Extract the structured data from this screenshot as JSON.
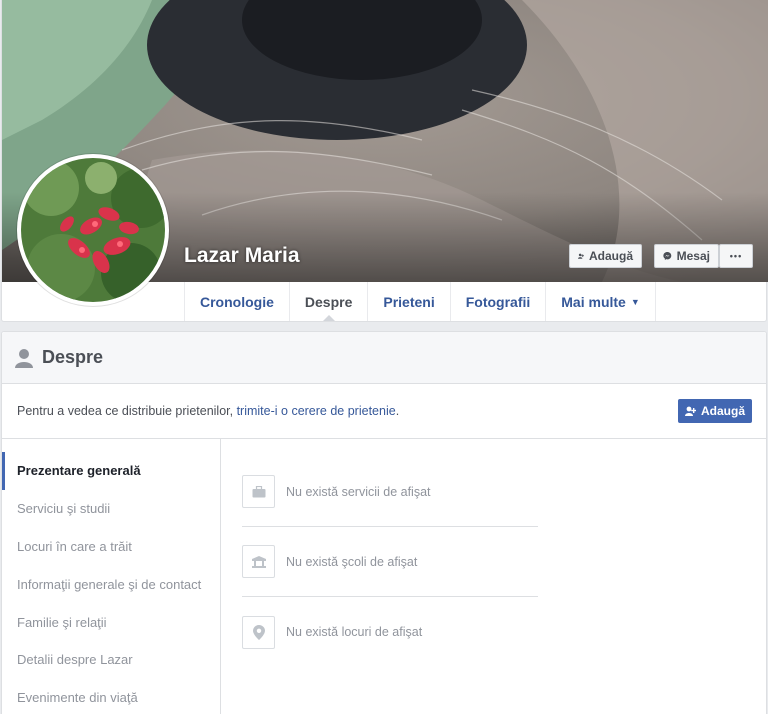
{
  "profile": {
    "name": "Lazar Maria",
    "add_friend_label": "Adaugă",
    "message_label": "Mesaj",
    "more_label": "•••"
  },
  "nav": {
    "tabs": [
      {
        "label": "Cronologie"
      },
      {
        "label": "Despre"
      },
      {
        "label": "Prieteni"
      },
      {
        "label": "Fotografii"
      },
      {
        "label": "Mai multe"
      }
    ],
    "active": "Despre"
  },
  "about": {
    "title": "Despre",
    "notice_prefix": "Pentru a vedea ce distribuie prietenilor, ",
    "notice_link": "trimite-i o cerere de prietenie",
    "notice_suffix": ".",
    "add_friend_label": "Adaugă",
    "sidebar": [
      {
        "label": "Prezentare generală"
      },
      {
        "label": "Serviciu şi studii"
      },
      {
        "label": "Locuri în care a trăit"
      },
      {
        "label": "Informaţii generale şi de contact"
      },
      {
        "label": "Familie şi relaţii"
      },
      {
        "label": "Detalii despre Lazar"
      },
      {
        "label": "Evenimente din viaţă"
      }
    ],
    "empty_states": [
      {
        "icon": "briefcase-icon",
        "text": "Nu există servicii de afişat"
      },
      {
        "icon": "school-icon",
        "text": "Nu există şcoli de afişat"
      },
      {
        "icon": "location-pin-icon",
        "text": "Nu există locuri de afişat"
      }
    ]
  },
  "colors": {
    "link": "#365899",
    "primary_button": "#4267b2",
    "page_bg": "#e9ebee"
  }
}
